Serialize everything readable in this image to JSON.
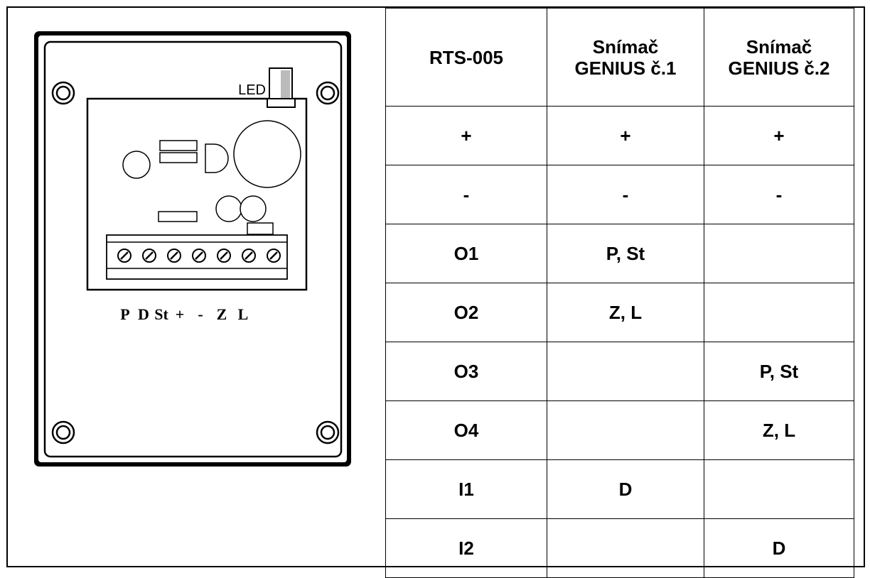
{
  "diagram": {
    "led_label": "LED",
    "terminal_labels": [
      "P",
      "D",
      "St",
      "+",
      "-",
      "Z",
      "L"
    ]
  },
  "table": {
    "headers": [
      [
        "RTS-005"
      ],
      [
        "Snímač",
        "GENIUS č.1"
      ],
      [
        "Snímač",
        "GENIUS č.2"
      ]
    ],
    "rows": [
      [
        "+",
        "+",
        "+"
      ],
      [
        "-",
        "-",
        "-"
      ],
      [
        "O1",
        "P, St",
        ""
      ],
      [
        "O2",
        "Z, L",
        ""
      ],
      [
        "O3",
        "",
        "P, St"
      ],
      [
        "O4",
        "",
        "Z, L"
      ],
      [
        "I1",
        "D",
        ""
      ],
      [
        "I2",
        "",
        "D"
      ]
    ]
  }
}
